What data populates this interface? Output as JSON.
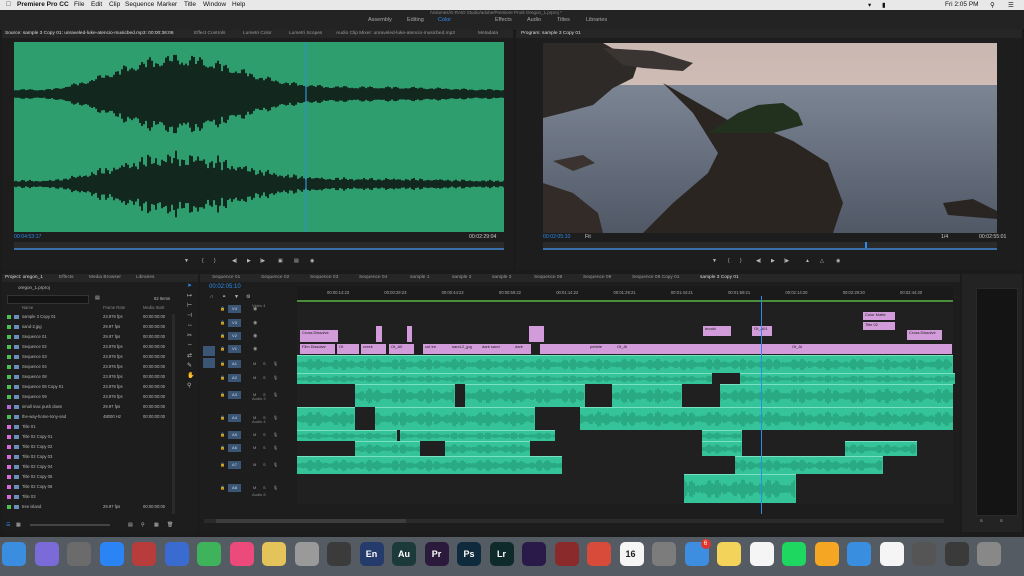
{
  "menubar": {
    "app": "Premiere Pro CC",
    "menus": [
      "File",
      "Edit",
      "Clip",
      "Sequence",
      "Marker",
      "Title",
      "Window",
      "Help"
    ],
    "time": "Fri 2:05 PM"
  },
  "window": {
    "path": "/Volumes/G-RAID Studio/adobe/Premiere Pro/6 Oregon_1.prproj *"
  },
  "workspaces": [
    "Assembly",
    "Editing",
    "Color",
    "Effects",
    "Audio",
    "Titles",
    "Libraries"
  ],
  "active_workspace": "Color",
  "source": {
    "tabs": [
      "Source: sample 3 Copy 01: unraveled-luke-atencio-musicbed.mp3: 00:00:36:06",
      "Effect Controls",
      "Lumetri Color",
      "Lumetri Scopes",
      "Audio Clip Mixer: unraveled-luke-atencio-musicbed.mp3",
      "Metadata"
    ],
    "timecode_in": "00:04:53:17",
    "timecode_duration": "00:02:29:04"
  },
  "program": {
    "tab": "Program: sample 3 Copy 01",
    "timecode": "00:02:05:10",
    "fit": "Fit",
    "resolution": "1/4",
    "duration": "00:02:55:01"
  },
  "project": {
    "tabs": [
      "Project: oregon_1",
      "Effects",
      "Media Browser",
      "Libraries"
    ],
    "file": "oregon_1.prproj",
    "items_count": "62 Items",
    "columns": [
      "Name",
      "Frame Rate",
      "Media Start"
    ],
    "rows": [
      {
        "name": "sample 3 Copy 01",
        "fps": "23.976 fps",
        "start": "00:00:00:00",
        "color": "#4fbf4f"
      },
      {
        "name": "sand-2.jpg",
        "fps": "29.97 fps",
        "start": "00:00:00:00",
        "color": "#4fbf4f"
      },
      {
        "name": "Sequence 01",
        "fps": "29.97 fps",
        "start": "00:00:00:00",
        "color": "#4fbf4f"
      },
      {
        "name": "Sequence 02",
        "fps": "23.976 fps",
        "start": "00:00:00:00",
        "color": "#4fbf4f"
      },
      {
        "name": "Sequence 03",
        "fps": "23.976 fps",
        "start": "00:00:00:00",
        "color": "#4fbf4f"
      },
      {
        "name": "Sequence 04",
        "fps": "23.976 fps",
        "start": "00:00:00:00",
        "color": "#4fbf4f"
      },
      {
        "name": "Sequence 08",
        "fps": "23.976 fps",
        "start": "00:00:00:00",
        "color": "#4fbf4f"
      },
      {
        "name": "Sequence 08 Copy 01",
        "fps": "23.976 fps",
        "start": "00:00:00:00",
        "color": "#4fbf4f"
      },
      {
        "name": "Sequence 09",
        "fps": "23.976 fps",
        "start": "00:00:00:00",
        "color": "#4fbf4f"
      },
      {
        "name": "small mac push down",
        "fps": "29.97 fps",
        "start": "00:00:00:00",
        "color": "#b36bd1"
      },
      {
        "name": "the-way-home-tony-and",
        "fps": "48000 Hz",
        "start": "00:00:00:00",
        "color": "#4fbf4f"
      },
      {
        "name": "Title 01",
        "fps": "",
        "start": "",
        "color": "#d86bd8"
      },
      {
        "name": "Title 02 Copy 01",
        "fps": "",
        "start": "",
        "color": "#d86bd8"
      },
      {
        "name": "Title 02 Copy 02",
        "fps": "",
        "start": "",
        "color": "#d86bd8"
      },
      {
        "name": "Title 02 Copy 03",
        "fps": "",
        "start": "",
        "color": "#d86bd8"
      },
      {
        "name": "Title 02 Copy 04",
        "fps": "",
        "start": "",
        "color": "#d86bd8"
      },
      {
        "name": "Title 02 Copy 05",
        "fps": "",
        "start": "",
        "color": "#d86bd8"
      },
      {
        "name": "Title 02 Copy 06",
        "fps": "",
        "start": "",
        "color": "#d86bd8"
      },
      {
        "name": "Title 03",
        "fps": "",
        "start": "",
        "color": "#d86bd8"
      },
      {
        "name": "tree island",
        "fps": "29.97 fps",
        "start": "00:00:00:00",
        "color": "#4fbf4f"
      }
    ]
  },
  "timeline": {
    "tabs": [
      "Sequence 01",
      "Sequence 02",
      "Sequence 03",
      "Sequence 04",
      "sample 1",
      "sample 2",
      "sample 3",
      "Sequence 08",
      "Sequence 09",
      "Sequence 08 Copy 01",
      "sample 3 Copy 01"
    ],
    "timecode": "00:02:05:10",
    "ruler": [
      "00:00:14:23",
      "00:00:29:23",
      "00:00:44:22",
      "00:00:59:22",
      "00:01:14:22",
      "00:01:29:21",
      "00:01:44:21",
      "00:01:59:21",
      "00:02:14:20",
      "00:02:29:20",
      "00:02:44:20"
    ],
    "video_tracks": [
      "V4",
      "V3",
      "V2",
      "V1"
    ],
    "audio_tracks": [
      "A1",
      "A2",
      "A3",
      "A4",
      "A5",
      "A6",
      "A7",
      "A8"
    ],
    "track_labels": {
      "video4": "Video 4",
      "audio3": "Audio 3",
      "audio4": "Audio 4",
      "audio8": "Audio 8"
    },
    "v1_clips": [
      "Film Dissolve",
      "Ot",
      "creek",
      "Ot_A0",
      "cut tre",
      "sand-2_jpg",
      "dark sand",
      "dark",
      "pebble",
      "Ot_Ai",
      "Ot_Ai"
    ],
    "v2_clips": [
      "Cross Dissolve",
      "Film Dissolve",
      "brooki",
      "Ot_A01"
    ],
    "v3_clips": [
      "Color Matte",
      "Title 02",
      "Cross Dissolve"
    ],
    "playhead_fraction": 0.71
  },
  "dock": [
    "Finder",
    "Siri",
    "Launchpad",
    "App Store",
    "Dictionary",
    "Keynote",
    "Numbers",
    "iTunes",
    "Notes",
    "Scripts",
    "Final Cut",
    "En",
    "Au",
    "Pr",
    "Ps",
    "Lr",
    "Ae",
    "Screen",
    "Creative Cloud",
    "Calendar",
    "System Prefs",
    "Mail",
    "Notes2",
    "TextEdit",
    "Spotify",
    "Photos",
    "Safari",
    "Chrome",
    "Preview",
    "Finder2",
    "Trash"
  ],
  "dock_calendar_day": "16",
  "dock_mail_badge": "6",
  "colors": {
    "accent": "#2d8ceb",
    "audio_clip": "#35c49a",
    "video_clip": "#d29bd9",
    "waveform_bg": "#2e9e6e"
  }
}
